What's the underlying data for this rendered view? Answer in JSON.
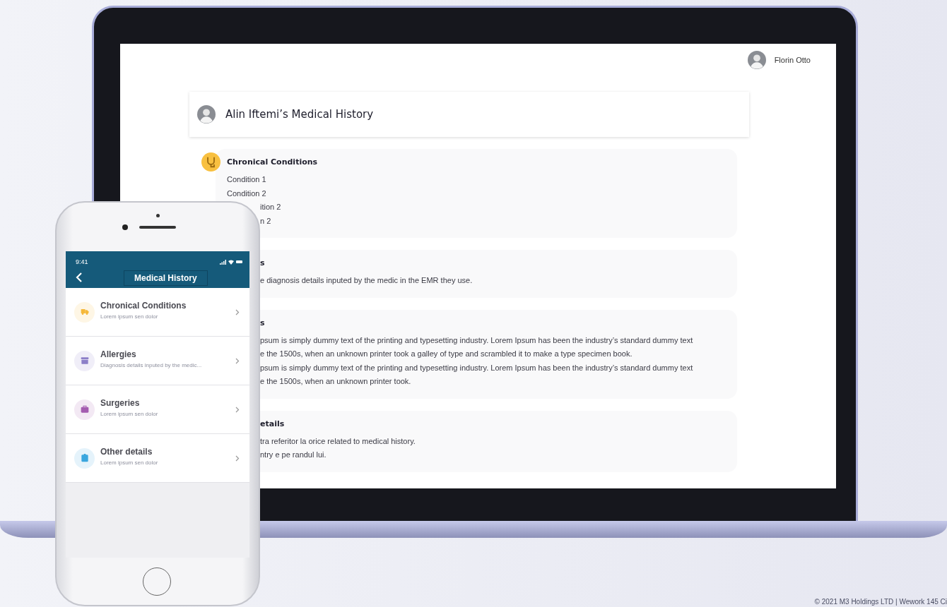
{
  "laptop": {
    "user": {
      "name": "Florin Otto"
    },
    "header": {
      "title": "Alin Iftemi’s Medical History"
    },
    "sections": [
      {
        "title": {
          "text": "Chronical Conditions"
        },
        "lines": [
          {
            "text": "Condition 1"
          },
          {
            "text": "Condition 2"
          },
          {
            "text": "ition 2",
            "cut": true
          },
          {
            "text": "n 2",
            "cut": true
          }
        ]
      },
      {
        "title": {
          "text": "s",
          "cut": true
        },
        "lines": [
          {
            "text": "e diagnosis details inputed by the medic in the EMR they use.",
            "cut": true
          }
        ]
      },
      {
        "title": {
          "text": "s",
          "cut": true
        },
        "lines": [
          {
            "text": "psum is simply dummy text of the printing and typesetting industry. Lorem Ipsum has been the industry’s standard dummy text",
            "cut": true
          },
          {
            "text": "e the 1500s, when an unknown printer took a galley of type and scrambled it to make a type specimen book.",
            "cut": true
          },
          {
            "text": "psum is simply dummy text of the printing and typesetting industry. Lorem Ipsum has been the industry’s standard dummy text",
            "cut": true
          },
          {
            "text": "e the 1500s, when an unknown printer took.",
            "cut": true
          }
        ]
      },
      {
        "title": {
          "text": "etails",
          "cut": true
        },
        "lines": [
          {
            "text": "tra referitor la orice related to medical history.",
            "cut": true
          },
          {
            "text": "ntry e pe randul lui.",
            "cut": true
          }
        ]
      }
    ]
  },
  "phone": {
    "status": {
      "time": "9:41"
    },
    "nav": {
      "title": "Medical History"
    },
    "items": [
      {
        "title": "Chronical Conditions",
        "subtitle": "Lorem ipsum sen dolor",
        "color": "#f5b83a"
      },
      {
        "title": "Allergies",
        "subtitle": "Diagnosis details inputed by the medic...",
        "color": "#8c7fc8"
      },
      {
        "title": "Surgeries",
        "subtitle": "Lorem ipsum sen dolor",
        "color": "#a45cb0"
      },
      {
        "title": "Other details",
        "subtitle": "Lorem ipsum sen dolor",
        "color": "#3aa6de"
      }
    ]
  },
  "footer": "© 2021 M3 Holdings LTD | Wework 145 Ci"
}
